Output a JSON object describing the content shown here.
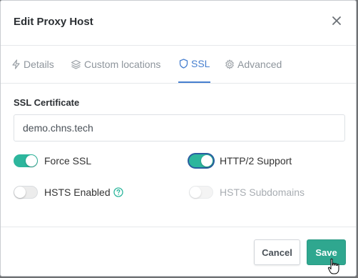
{
  "dialog": {
    "title": "Edit Proxy Host",
    "close_icon": "close-icon"
  },
  "tabs": [
    {
      "label": "Details",
      "icon": "lightning-bolt-icon",
      "active": false
    },
    {
      "label": "Custom locations",
      "icon": "layers-icon",
      "active": false
    },
    {
      "label": "SSL",
      "icon": "shield-icon",
      "active": true
    },
    {
      "label": "Advanced",
      "icon": "gear-icon",
      "active": false
    }
  ],
  "ssl": {
    "certificate_label": "SSL Certificate",
    "certificate_value": "demo.chns.tech",
    "options": {
      "force_ssl": {
        "label": "Force SSL",
        "checked": true,
        "disabled": false
      },
      "http2_support": {
        "label": "HTTP/2 Support",
        "checked": true,
        "disabled": false,
        "focused": true
      },
      "hsts_enabled": {
        "label": "HSTS Enabled",
        "checked": false,
        "disabled": false,
        "help_icon": "question-circle-icon"
      },
      "hsts_subdomains": {
        "label": "HSTS Subdomains",
        "checked": false,
        "disabled": true
      }
    }
  },
  "footer": {
    "cancel_label": "Cancel",
    "save_label": "Save"
  },
  "colors": {
    "accent_blue": "#467fcf",
    "toggle_on": "#2db69d",
    "save_button": "#2fa78f"
  }
}
